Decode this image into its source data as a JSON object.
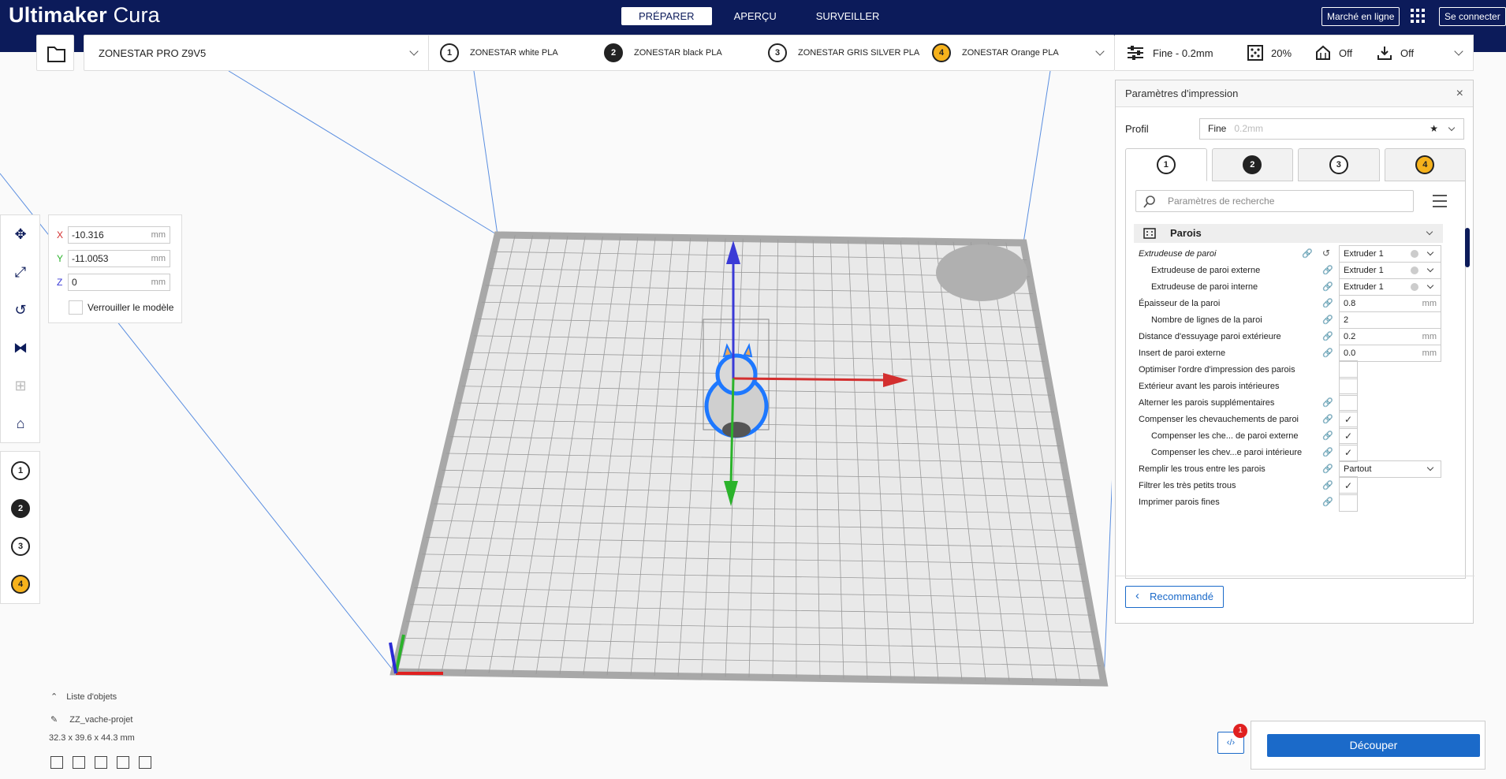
{
  "app": {
    "brand": "Ultimaker",
    "product": "Cura"
  },
  "nav": {
    "tabs": [
      "PRÉPARER",
      "APERÇU",
      "SURVEILLER"
    ]
  },
  "header": {
    "marketplace": "Marché en ligne",
    "login": "Se connecter"
  },
  "toolbar": {
    "printer": "ZONESTAR PRO Z9V5",
    "extruders": [
      {
        "num": "1",
        "name": "ZONESTAR white PLA"
      },
      {
        "num": "2",
        "name": "ZONESTAR black PLA"
      },
      {
        "num": "3",
        "name": "ZONESTAR GRIS SILVER PLA"
      },
      {
        "num": "4",
        "name": "ZONESTAR Orange PLA"
      }
    ],
    "profile": "Fine - 0.2mm",
    "infill": "20%",
    "support": "Off",
    "adhesion": "Off"
  },
  "move_tool": {
    "x_label": "X",
    "x": "-10.316",
    "y_label": "Y",
    "y": "-11.0053",
    "z_label": "Z",
    "z": "0",
    "unit": "mm",
    "lock_label": "Verrouiller le modèle"
  },
  "colors": {
    "header": "#0c1b5a",
    "accent": "#1b6ac9",
    "x_axis": "#d32f2f",
    "y_axis": "#2bb32b",
    "z_axis": "#3a3ad6",
    "model_outline": "#1e78ff"
  },
  "settings": {
    "title": "Paramètres d'impression",
    "profil_label": "Profil",
    "profil_value": "Fine",
    "profil_sub": "0.2mm",
    "search_placeholder": "Paramètres de recherche",
    "category": "Parois",
    "rows": [
      {
        "label": "Extrudeuse de paroi",
        "value": "Extruder 1"
      },
      {
        "label": "Extrudeuse de paroi externe",
        "value": "Extruder 1"
      },
      {
        "label": "Extrudeuse de paroi interne",
        "value": "Extruder 1"
      },
      {
        "label": "Épaisseur de la paroi",
        "value": "0.8",
        "unit": "mm"
      },
      {
        "label": "Nombre de lignes de la paroi",
        "value": "2"
      },
      {
        "label": "Distance d'essuyage paroi extérieure",
        "value": "0.2",
        "unit": "mm"
      },
      {
        "label": "Insert de paroi externe",
        "value": "0.0",
        "unit": "mm"
      },
      {
        "label": "Optimiser l'ordre d'impression des parois",
        "value": ""
      },
      {
        "label": "Extérieur avant les parois intérieures",
        "value": ""
      },
      {
        "label": "Alterner les parois supplémentaires",
        "value": ""
      },
      {
        "label": "Compenser les chevauchements de paroi",
        "value": "✓"
      },
      {
        "label": "Compenser les che... de paroi externe",
        "value": "✓"
      },
      {
        "label": "Compenser les chev...e paroi intérieure",
        "value": "✓"
      },
      {
        "label": "Remplir les trous entre les parois",
        "value": "Partout"
      },
      {
        "label": "Filtrer les très petits trous",
        "value": "✓"
      },
      {
        "label": "Imprimer parois fines",
        "value": ""
      }
    ],
    "recommended": "Recommandé"
  },
  "objects": {
    "list_label": "Liste d'objets",
    "model_name": "ZZ_vache-projet",
    "dimensions": "32.3 x 39.6 x 44.3 mm"
  },
  "slice": {
    "button": "Découper",
    "notifications": "1",
    "code_icon": "‹/›"
  }
}
